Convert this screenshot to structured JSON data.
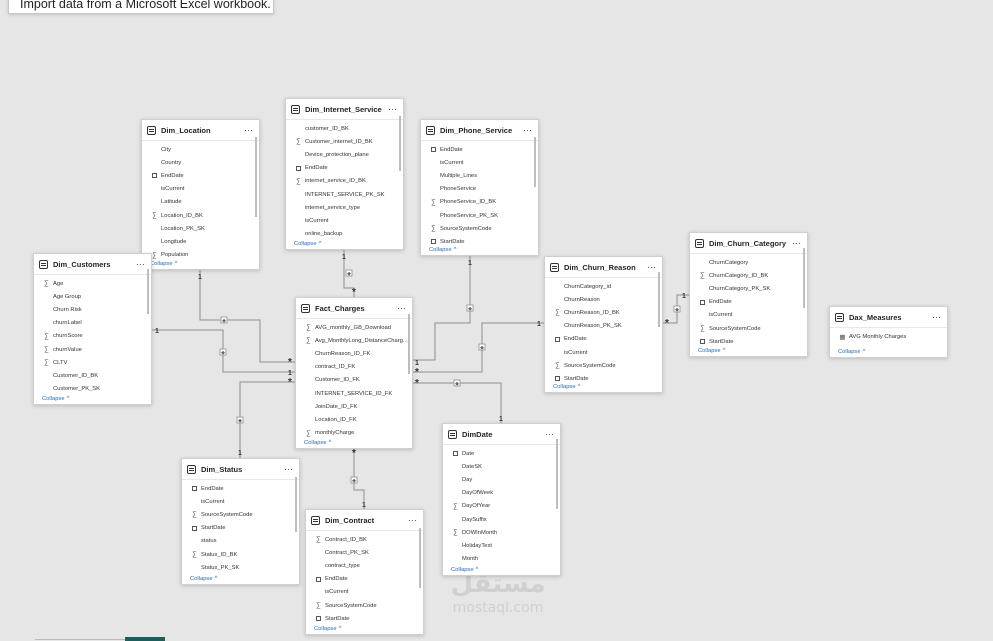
{
  "tooltip": {
    "text": "Import data from a Microsoft Excel workbook."
  },
  "collapse_label": "Collapse",
  "watermark": {
    "logo": "مستقل",
    "text": "mostaql.com"
  },
  "tables": [
    {
      "id": "dim-location",
      "title": "Dim_Location",
      "fields": [
        {
          "icon": "",
          "name": "City"
        },
        {
          "icon": "",
          "name": "Country"
        },
        {
          "icon": "calendar",
          "name": "EndDate"
        },
        {
          "icon": "",
          "name": "isCurrent"
        },
        {
          "icon": "",
          "name": "Latitude"
        },
        {
          "icon": "sigma",
          "name": "Location_ID_BK"
        },
        {
          "icon": "",
          "name": "Location_PK_SK"
        },
        {
          "icon": "",
          "name": "Longitude"
        },
        {
          "icon": "sigma",
          "name": "Population"
        }
      ]
    },
    {
      "id": "dim-internet-service",
      "title": "Dim_Internet_Service",
      "fields": [
        {
          "icon": "",
          "name": "customer_ID_BK"
        },
        {
          "icon": "sigma",
          "name": "Customer_internet_ID_BK"
        },
        {
          "icon": "",
          "name": "Device_protection_plane"
        },
        {
          "icon": "calendar",
          "name": "EndDate"
        },
        {
          "icon": "sigma",
          "name": "internet_service_ID_BK"
        },
        {
          "icon": "",
          "name": "INTERNET_SERVICE_PK_SK"
        },
        {
          "icon": "",
          "name": "internet_service_type"
        },
        {
          "icon": "",
          "name": "isCurrent"
        },
        {
          "icon": "",
          "name": "online_backup"
        }
      ]
    },
    {
      "id": "dim-phone-service",
      "title": "Dim_Phone_Service",
      "fields": [
        {
          "icon": "calendar",
          "name": "EndDate"
        },
        {
          "icon": "",
          "name": "isCurrent"
        },
        {
          "icon": "",
          "name": "Multiple_Lines"
        },
        {
          "icon": "",
          "name": "PhoneService"
        },
        {
          "icon": "sigma",
          "name": "PhoneService_ID_BK"
        },
        {
          "icon": "",
          "name": "PhoneService_PK_SK"
        },
        {
          "icon": "sigma",
          "name": "SourceSystemCode"
        },
        {
          "icon": "calendar",
          "name": "StartDate"
        }
      ]
    },
    {
      "id": "dim-customers",
      "title": "Dim_Customers",
      "fields": [
        {
          "icon": "sigma",
          "name": "Age"
        },
        {
          "icon": "",
          "name": "Age Group"
        },
        {
          "icon": "",
          "name": "Churn Risk"
        },
        {
          "icon": "",
          "name": "churnLabel"
        },
        {
          "icon": "sigma",
          "name": "churnScore"
        },
        {
          "icon": "sigma",
          "name": "churnValue"
        },
        {
          "icon": "sigma",
          "name": "CLTV"
        },
        {
          "icon": "",
          "name": "Customer_ID_BK"
        },
        {
          "icon": "",
          "name": "Customer_PK_SK"
        }
      ]
    },
    {
      "id": "fact-charges",
      "title": "Fact_Charges",
      "fields": [
        {
          "icon": "sigma",
          "name": "AVG_monthly_GB_Download"
        },
        {
          "icon": "sigma",
          "name": "Avg_MonthlyLong_DistanceCharg..."
        },
        {
          "icon": "",
          "name": "ChurnReason_ID_FK"
        },
        {
          "icon": "",
          "name": "contract_ID_FK"
        },
        {
          "icon": "",
          "name": "Customer_ID_FK"
        },
        {
          "icon": "",
          "name": "INTERNET_SERVICE_ID_FK"
        },
        {
          "icon": "",
          "name": "JoinDate_ID_FK"
        },
        {
          "icon": "",
          "name": "Location_ID_FK"
        },
        {
          "icon": "sigma",
          "name": "monthlyCharge"
        }
      ]
    },
    {
      "id": "dim-churn-reason",
      "title": "Dim_Churn_Reason",
      "fields": [
        {
          "icon": "",
          "name": "ChurnCategory_id"
        },
        {
          "icon": "",
          "name": "ChurnReason"
        },
        {
          "icon": "sigma",
          "name": "ChurnReason_ID_BK"
        },
        {
          "icon": "",
          "name": "ChurnReason_PK_SK"
        },
        {
          "icon": "calendar",
          "name": "EndDate"
        },
        {
          "icon": "",
          "name": "isCurrent"
        },
        {
          "icon": "sigma",
          "name": "SourceSystemCode"
        },
        {
          "icon": "calendar",
          "name": "StartDate"
        }
      ]
    },
    {
      "id": "dim-churn-category",
      "title": "Dim_Churn_Category",
      "fields": [
        {
          "icon": "",
          "name": "ChurnCategory"
        },
        {
          "icon": "sigma",
          "name": "ChurnCategory_ID_BK"
        },
        {
          "icon": "",
          "name": "ChurnCategory_PK_SK"
        },
        {
          "icon": "calendar",
          "name": "EndDate"
        },
        {
          "icon": "",
          "name": "isCurrent"
        },
        {
          "icon": "sigma",
          "name": "SourceSystemCode"
        },
        {
          "icon": "calendar",
          "name": "StartDate"
        }
      ]
    },
    {
      "id": "dax-measures",
      "title": "Dax_Measures",
      "fields": [
        {
          "icon": "calc",
          "name": "AVG Monthly Charges"
        }
      ]
    },
    {
      "id": "dim-status",
      "title": "Dim_Status",
      "fields": [
        {
          "icon": "calendar",
          "name": "EndDate"
        },
        {
          "icon": "",
          "name": "isCurrent"
        },
        {
          "icon": "sigma",
          "name": "SourceSystemCode"
        },
        {
          "icon": "calendar",
          "name": "StartDate"
        },
        {
          "icon": "",
          "name": "status"
        },
        {
          "icon": "sigma",
          "name": "Status_ID_BK"
        },
        {
          "icon": "",
          "name": "Status_PK_SK"
        }
      ]
    },
    {
      "id": "dim-contract",
      "title": "Dim_Contract",
      "fields": [
        {
          "icon": "sigma",
          "name": "Contract_ID_BK"
        },
        {
          "icon": "",
          "name": "Contract_PK_SK"
        },
        {
          "icon": "",
          "name": "contract_type"
        },
        {
          "icon": "calendar",
          "name": "EndDate"
        },
        {
          "icon": "",
          "name": "isCurrent"
        },
        {
          "icon": "sigma",
          "name": "SourceSystemCode"
        },
        {
          "icon": "calendar",
          "name": "StartDate"
        }
      ]
    },
    {
      "id": "dimdate",
      "title": "DimDate",
      "fields": [
        {
          "icon": "calendar",
          "name": "Date"
        },
        {
          "icon": "",
          "name": "DateSK"
        },
        {
          "icon": "",
          "name": "Day"
        },
        {
          "icon": "",
          "name": "DayOfWeek"
        },
        {
          "icon": "sigma",
          "name": "DayOfYear"
        },
        {
          "icon": "",
          "name": "DaySuffix"
        },
        {
          "icon": "sigma",
          "name": "DOWInMonth"
        },
        {
          "icon": "",
          "name": "HolidayText"
        },
        {
          "icon": "",
          "name": "Month"
        }
      ]
    }
  ],
  "relationships": [
    {
      "from": "dim-location",
      "to": "fact-charges",
      "one_side": "1",
      "many_side": "*"
    },
    {
      "from": "dim-internet-service",
      "to": "fact-charges",
      "one_side": "1",
      "many_side": "*"
    },
    {
      "from": "dim-phone-service",
      "to": "fact-charges",
      "one_side": "1",
      "many_side": "1"
    },
    {
      "from": "dim-customers",
      "to": "fact-charges",
      "one_side": "1",
      "many_side": "1"
    },
    {
      "from": "dim-churn-reason",
      "to": "fact-charges",
      "one_side": "1",
      "many_side": "*"
    },
    {
      "from": "dim-churn-category",
      "to": "dim-churn-reason",
      "one_side": "1",
      "many_side": "*"
    },
    {
      "from": "dim-status",
      "to": "fact-charges",
      "one_side": "1",
      "many_side": "*"
    },
    {
      "from": "dim-contract",
      "to": "fact-charges",
      "one_side": "1",
      "many_side": "*"
    },
    {
      "from": "dimdate",
      "to": "fact-charges",
      "one_side": "1",
      "many_side": "*"
    }
  ]
}
